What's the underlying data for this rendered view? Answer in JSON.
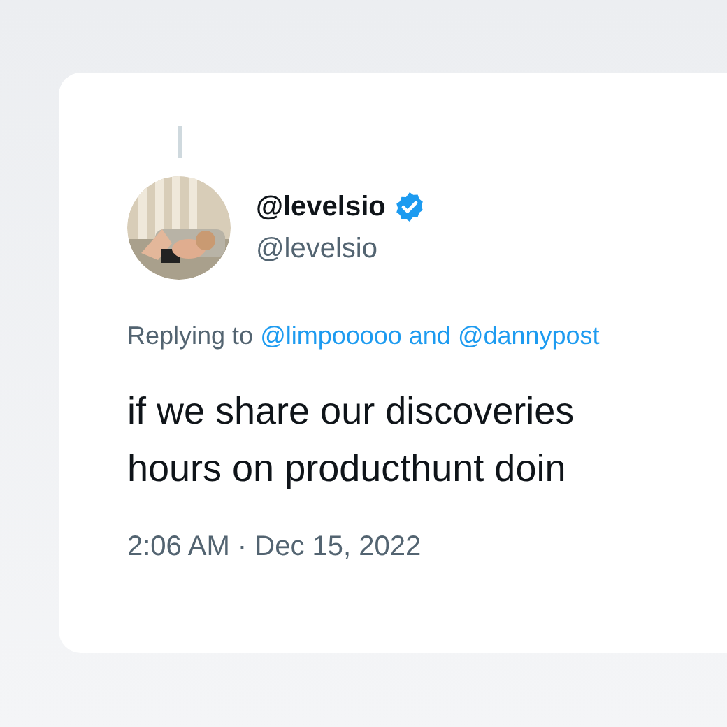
{
  "tweet": {
    "thread_line": true,
    "display_name": "@levelsio",
    "verified": true,
    "handle": "@levelsio",
    "replying_prefix": "Replying to",
    "replying_to": "@limpooooo and @dannypost",
    "text_lines": [
      "if we share our discoveries",
      "hours on producthunt doin"
    ],
    "timestamp": "2:06 AM · Dec 15, 2022"
  }
}
